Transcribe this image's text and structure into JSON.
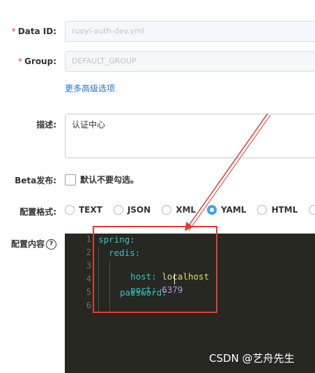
{
  "form": {
    "data_id": {
      "label": "Data ID:",
      "required_mark": "*",
      "value": "ruoyi-auth-dev.yml"
    },
    "group": {
      "label": "Group:",
      "required_mark": "*",
      "value": "DEFAULT_GROUP"
    },
    "advanced_link": "更多高级选项",
    "description": {
      "label": "描述:",
      "value": "认证中心"
    },
    "beta": {
      "label": "Beta发布:",
      "checkbox_text": "默认不要勾选。",
      "checked": false
    },
    "format": {
      "label": "配置格式:",
      "options": [
        "TEXT",
        "JSON",
        "XML",
        "YAML",
        "HTML"
      ],
      "selected": "YAML"
    },
    "content": {
      "label": "配置内容",
      "help_glyph": "?"
    }
  },
  "editor": {
    "line_numbers": [
      "1",
      "2",
      "3",
      "4",
      "5",
      "6"
    ],
    "lines": {
      "l1_key": "spring:",
      "l2_key": "redis:",
      "l3_key": "host:",
      "l3_val": "localhost",
      "l4_key": "port:",
      "l4_val": "6379",
      "l5_key": "password:"
    }
  },
  "annotation": {
    "highlight_color": "#e53935"
  },
  "watermark": "CSDN @艺舟先生"
}
